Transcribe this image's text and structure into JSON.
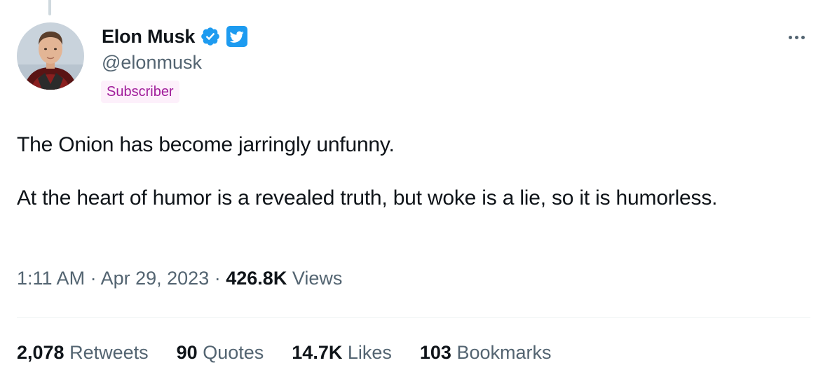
{
  "author": {
    "name": "Elon Musk",
    "handle": "@elonmusk",
    "badge": "Subscriber",
    "verified_icon": "verified-badge-icon",
    "brand_icon": "twitter-bird-icon"
  },
  "tweet": {
    "paragraphs": [
      "The Onion has become jarringly unfunny.",
      "At the heart of humor is a revealed truth, but woke is a lie, so it is humorless."
    ]
  },
  "meta": {
    "time": "1:11 AM",
    "separator": "·",
    "date": "Apr 29, 2023",
    "views_count": "426.8K",
    "views_label": "Views"
  },
  "stats": [
    {
      "count": "2,078",
      "label": "Retweets"
    },
    {
      "count": "90",
      "label": "Quotes"
    },
    {
      "count": "14.7K",
      "label": "Likes"
    },
    {
      "count": "103",
      "label": "Bookmarks"
    }
  ],
  "colors": {
    "accent": "#1d9bf0",
    "text": "#0f1419",
    "secondary": "#536471",
    "subscriber_text": "#a01c9a",
    "subscriber_bg": "#fdf0fb"
  }
}
